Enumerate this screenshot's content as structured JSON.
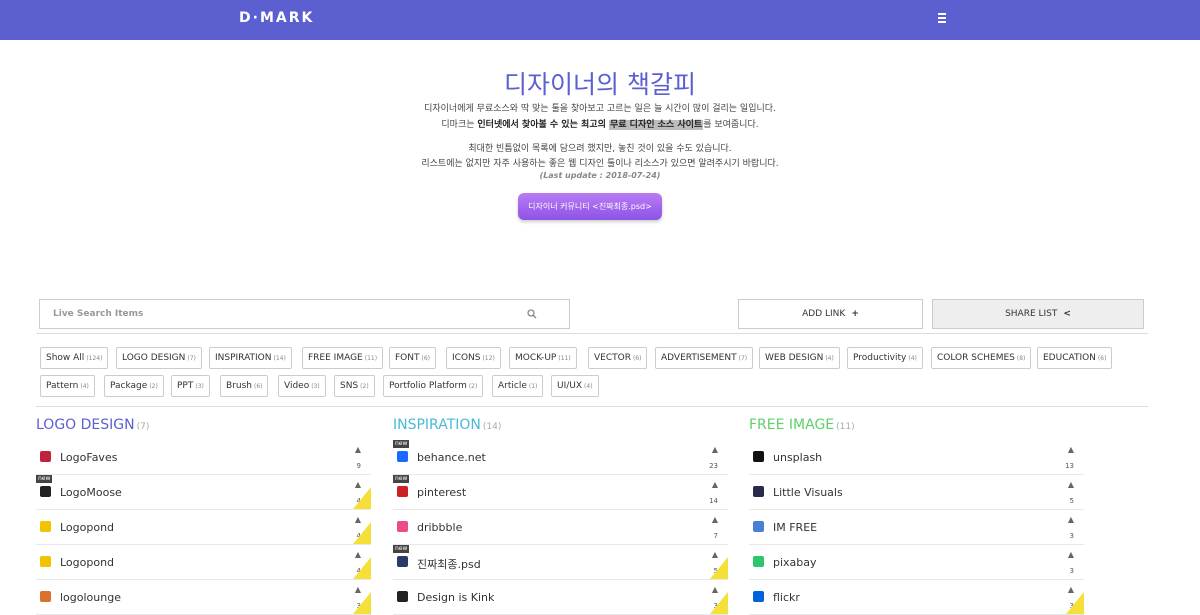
{
  "header": {
    "logo": "D·MARK"
  },
  "hero": {
    "title": "디자이너의 책갈피",
    "line1": "디자이너에게 무료소스와 딱 맞는 툴을 찾아보고 고르는 일은 늘 시간이 많이 걸리는 일입니다.",
    "line2_a": "디마크는 ",
    "line2_b": "인터넷에서 찾아볼 수 있는 최고의 ",
    "line2_c": "무료 디자인 소스 사이트",
    "line2_d": "를 보여줍니다.",
    "line3": "최대한 빈틈없이 목록에 담으려 했지만, 놓친 것이 있을 수도 있습니다.",
    "line4": "리스트에는 없지만 자주 사용하는 좋은 웹 디자인 툴이나 리소스가 있으면 알려주시기 바랍니다.",
    "update": "(Last update : 2018-07-24)",
    "community_button": "디자이너 커뮤니티 <진짜최종.psd>"
  },
  "search": {
    "placeholder": "Live Search Items"
  },
  "actions": {
    "add_link": "ADD LINK",
    "share_list": "SHARE LIST"
  },
  "categories": [
    {
      "label": "Show All",
      "count": "(124)"
    },
    {
      "label": "LOGO DESIGN",
      "count": "(7)"
    },
    {
      "label": "INSPIRATION",
      "count": "(14)"
    },
    {
      "label": "FREE IMAGE",
      "count": "(11)"
    },
    {
      "label": "FONT",
      "count": "(6)"
    },
    {
      "label": "ICONS",
      "count": "(12)"
    },
    {
      "label": "MOCK-UP",
      "count": "(11)"
    },
    {
      "label": "VECTOR",
      "count": "(6)"
    },
    {
      "label": "ADVERTISEMENT",
      "count": "(7)"
    },
    {
      "label": "WEB DESIGN",
      "count": "(4)"
    },
    {
      "label": "Productivity",
      "count": "(4)"
    },
    {
      "label": "COLOR SCHEMES",
      "count": "(8)"
    },
    {
      "label": "EDUCATION",
      "count": "(6)"
    },
    {
      "label": "Pattern",
      "count": "(4)"
    },
    {
      "label": "Package",
      "count": "(2)"
    },
    {
      "label": "PPT",
      "count": "(3)"
    },
    {
      "label": "Brush",
      "count": "(6)"
    },
    {
      "label": "Video",
      "count": "(3)"
    },
    {
      "label": "SNS",
      "count": "(2)"
    },
    {
      "label": "Portfolio Platform",
      "count": "(2)"
    },
    {
      "label": "Article",
      "count": "(1)"
    },
    {
      "label": "UI/UX",
      "count": "(4)"
    }
  ],
  "columns": [
    {
      "title": "LOGO DESIGN",
      "count": "(7)",
      "color": "#5b5fd0",
      "items": [
        {
          "name": "LogoFaves",
          "likes": "9",
          "new": false,
          "corner": false,
          "icon_color": "#c0243c",
          "icon": "heart-icon"
        },
        {
          "name": "LogoMoose",
          "likes": "4",
          "new": true,
          "corner": true,
          "icon_color": "#222222",
          "icon": "moose-icon"
        },
        {
          "name": "Logopond",
          "likes": "4",
          "new": false,
          "corner": true,
          "icon_color": "#f2c400",
          "icon": "heart-icon"
        },
        {
          "name": "Logopond",
          "likes": "4",
          "new": false,
          "corner": true,
          "icon_color": "#f2c400",
          "icon": "heart-icon"
        },
        {
          "name": "logolounge",
          "likes": "3",
          "new": false,
          "corner": true,
          "icon_color": "#d9722a",
          "icon": "square-icon"
        }
      ]
    },
    {
      "title": "INSPIRATION",
      "count": "(14)",
      "color": "#49b9d8",
      "items": [
        {
          "name": "behance.net",
          "likes": "23",
          "new": true,
          "corner": false,
          "icon_color": "#1769ff",
          "icon": "behance-icon"
        },
        {
          "name": "pinterest",
          "likes": "14",
          "new": true,
          "corner": false,
          "icon_color": "#cb2027",
          "icon": "pinterest-icon"
        },
        {
          "name": "dribbble",
          "likes": "7",
          "new": false,
          "corner": false,
          "icon_color": "#ea4c89",
          "icon": "dribbble-icon"
        },
        {
          "name": "진짜최종.psd",
          "likes": "5",
          "new": true,
          "corner": true,
          "icon_color": "#2a3a6a",
          "icon": "psd-icon"
        },
        {
          "name": "Design is Kink",
          "likes": "3",
          "new": false,
          "corner": true,
          "icon_color": "#222222",
          "icon": "kink-icon"
        }
      ]
    },
    {
      "title": "FREE IMAGE",
      "count": "(11)",
      "color": "#5ed06a",
      "items": [
        {
          "name": "unsplash",
          "likes": "13",
          "new": false,
          "corner": false,
          "icon_color": "#111111",
          "icon": "unsplash-icon"
        },
        {
          "name": "Little Visuals",
          "likes": "5",
          "new": false,
          "corner": false,
          "icon_color": "#2a2a4a",
          "icon": "square-icon"
        },
        {
          "name": "IM FREE",
          "likes": "3",
          "new": false,
          "corner": false,
          "icon_color": "#4a7fd8",
          "icon": "globe-icon"
        },
        {
          "name": "pixabay",
          "likes": "3",
          "new": false,
          "corner": false,
          "icon_color": "#2ec66d",
          "icon": "pixabay-icon"
        },
        {
          "name": "flickr",
          "likes": "3",
          "new": false,
          "corner": true,
          "icon_color": "#0063dc",
          "icon": "flickr-icon"
        }
      ]
    }
  ]
}
